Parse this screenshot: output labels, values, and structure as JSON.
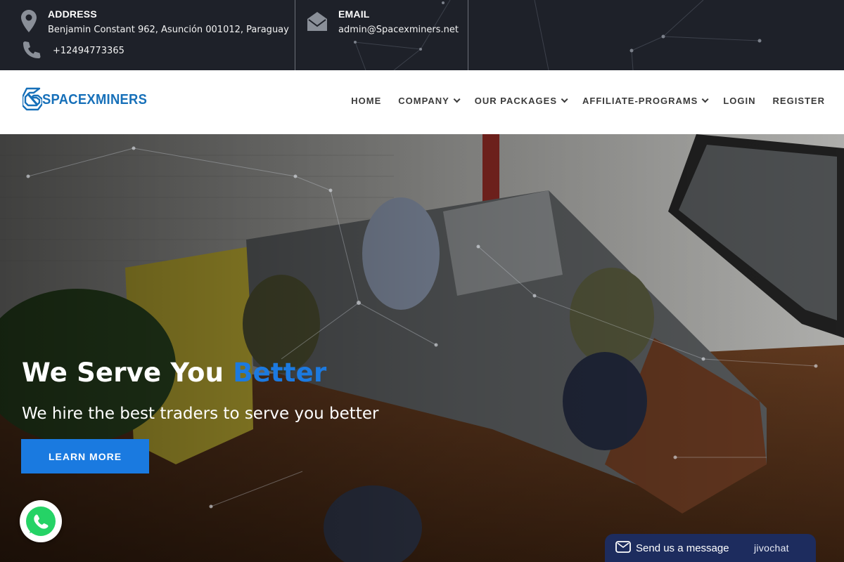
{
  "topbar": {
    "address": {
      "icon": "map-pin-icon",
      "title": "ADDRESS",
      "text": "Benjamin Constant 962, Asunción 001012, Paraguay"
    },
    "phone": {
      "icon": "phone-icon",
      "text": "+12494773365"
    },
    "email": {
      "icon": "envelope-icon",
      "title": "EMAIL",
      "text": "admin@Spacexminers.net"
    }
  },
  "brand": {
    "name": "SPACEXMINERS",
    "color": "#1770b9"
  },
  "nav": {
    "items": [
      {
        "label": "HOME",
        "dropdown": false
      },
      {
        "label": "COMPANY",
        "dropdown": true
      },
      {
        "label": "OUR PACKAGES",
        "dropdown": true
      },
      {
        "label": "AFFILIATE-PROGRAMS",
        "dropdown": true
      },
      {
        "label": "LOGIN",
        "dropdown": false
      },
      {
        "label": "REGISTER",
        "dropdown": false
      }
    ]
  },
  "hero": {
    "title_main": "We Serve You ",
    "title_accent": "Better",
    "subtitle": "We hire the best traders to serve you better",
    "cta_label": "LEARN MORE",
    "accent_color": "#1c7ae0"
  },
  "whatsapp": {
    "icon": "whatsapp-icon",
    "color": "#25d366"
  },
  "chat": {
    "icon": "chat-message-icon",
    "label": "Send us a message",
    "brand": "jivochat",
    "color": "#1d2c5e"
  }
}
